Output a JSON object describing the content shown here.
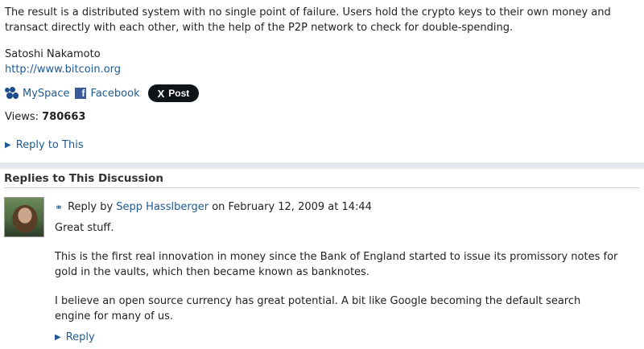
{
  "post": {
    "intro": "The result is a distributed system with no single point of failure. Users hold the crypto keys to their own money and transact directly with each other, with the help of the P2P network to check for double-spending.",
    "author": "Satoshi Nakamoto",
    "url": "http://www.bitcoin.org"
  },
  "share": {
    "myspace_label": "MySpace",
    "facebook_label": "Facebook",
    "facebook_glyph": "f",
    "x_glyph": "X",
    "x_post_label": "Post"
  },
  "views": {
    "label": "Views:",
    "count": "780663"
  },
  "reply_to_this": "Reply to This",
  "replies_section": {
    "title": "Replies to This Discussion",
    "replies": [
      {
        "prefix": "Reply by",
        "author": "Sepp Hasslberger",
        "on": "on",
        "date": "February 12, 2009 at 14:44",
        "paragraphs": [
          "Great stuff.",
          "This is the first real innovation in money since the Bank of England started to issue its promissory notes for gold in the vaults, which then became known as banknotes.",
          "I believe an open source currency has great potential. A bit like Google becoming the default search engine for many of us."
        ],
        "reply_label": "Reply"
      }
    ]
  },
  "colors": {
    "link": "#1f5a92",
    "separator": "#e3e8ee",
    "facebook": "#3b5998",
    "x_button": "#0f1419"
  }
}
